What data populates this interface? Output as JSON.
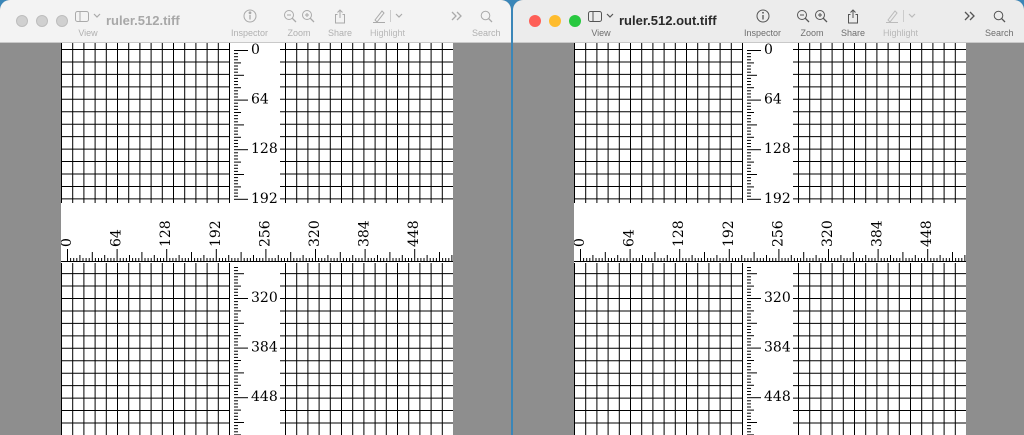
{
  "windows": [
    {
      "id": "left",
      "active": false,
      "title": "ruler.512.tiff",
      "toolbar": {
        "view": "View",
        "inspector": "Inspector",
        "zoom": "Zoom",
        "share": "Share",
        "highlight": "Highlight",
        "search": "Search"
      }
    },
    {
      "id": "right",
      "active": true,
      "title": "ruler.512.out.tiff",
      "toolbar": {
        "view": "View",
        "inspector": "Inspector",
        "zoom": "Zoom",
        "share": "Share",
        "highlight": "Highlight",
        "search": "Search"
      }
    }
  ],
  "ruler": {
    "vertical_labels": [
      "0",
      "64",
      "128",
      "192",
      "320",
      "384",
      "448"
    ],
    "horizontal_labels": [
      "0",
      "64",
      "128",
      "192",
      "256",
      "320",
      "384",
      "448"
    ]
  }
}
